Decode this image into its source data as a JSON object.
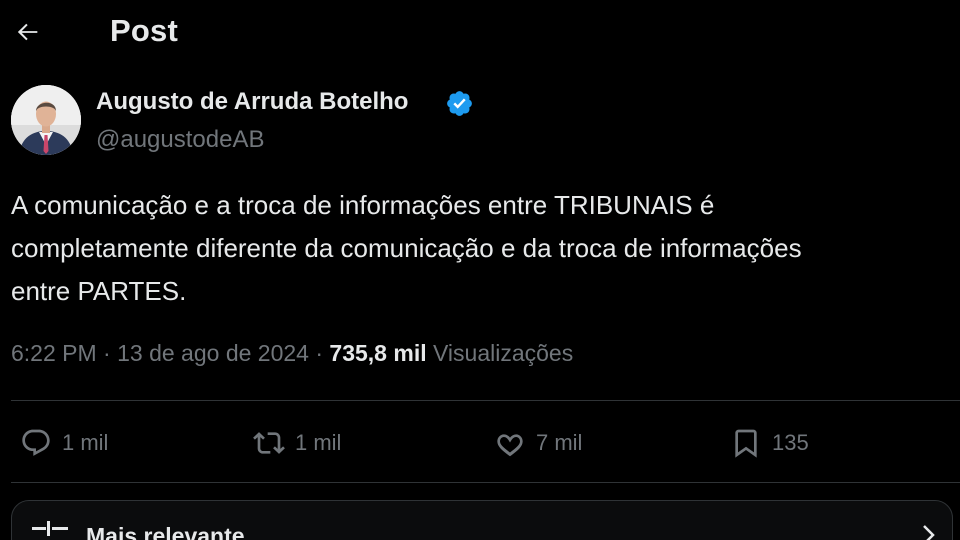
{
  "header": {
    "back_icon": "arrow-left-icon",
    "title": "Post"
  },
  "author": {
    "display_name": "Augusto de Arruda Botelho",
    "handle": "@augustodeAB",
    "verified_icon": "verified-badge-icon",
    "verified_color": "#1d9bf0"
  },
  "tweet": {
    "lines": [
      "A comunicação e a troca de informações entre TRIBUNAIS é",
      "completamente diferente da comunicação e da troca de informações",
      "entre PARTES."
    ]
  },
  "meta": {
    "time": "6:22 PM",
    "separator": "·",
    "date": "13 de ago de 2024",
    "views_count": "735,8 mil",
    "views_label": "Visualizações"
  },
  "actions": {
    "replies": {
      "icon": "reply-icon",
      "count": "1 mil"
    },
    "reposts": {
      "icon": "repost-icon",
      "count": "1 mil"
    },
    "likes": {
      "icon": "heart-icon",
      "count": "7 mil"
    },
    "bookmarks": {
      "icon": "bookmark-icon",
      "count": "135"
    }
  },
  "sort": {
    "icon": "filter-icon",
    "label": "Mais relevante",
    "chevron_icon": "chevron-right-icon"
  },
  "colors": {
    "background": "#000000",
    "text_primary": "#e7e9ea",
    "text_secondary": "#71767b",
    "divider": "#2f3336",
    "accent": "#1d9bf0"
  }
}
